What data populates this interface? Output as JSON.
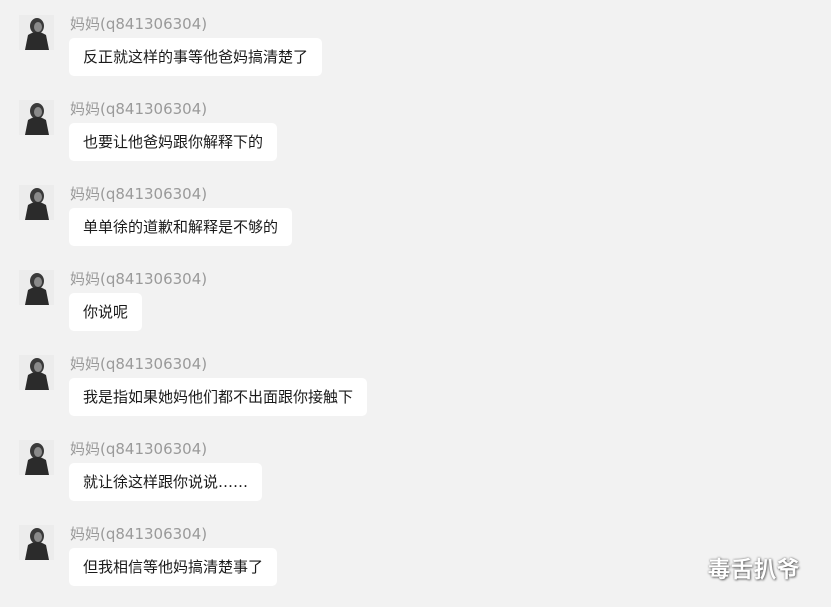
{
  "chat": {
    "sender_name": "妈妈(q841306304)",
    "messages": [
      {
        "text": "反正就这样的事等他爸妈搞清楚了"
      },
      {
        "text": "也要让他爸妈跟你解释下的"
      },
      {
        "text": "单单徐的道歉和解释是不够的"
      },
      {
        "text": "你说呢"
      },
      {
        "text": "我是指如果她妈他们都不出面跟你接触下"
      },
      {
        "text": "就让徐这样跟你说说……"
      },
      {
        "text": "但我相信等他妈搞清楚事了"
      }
    ]
  },
  "watermark": {
    "text": "毒舌扒爷"
  },
  "colors": {
    "background": "#f2f2f2",
    "bubble": "#ffffff",
    "sender_text": "#9a9a9a",
    "message_text": "#1a1a1a"
  }
}
